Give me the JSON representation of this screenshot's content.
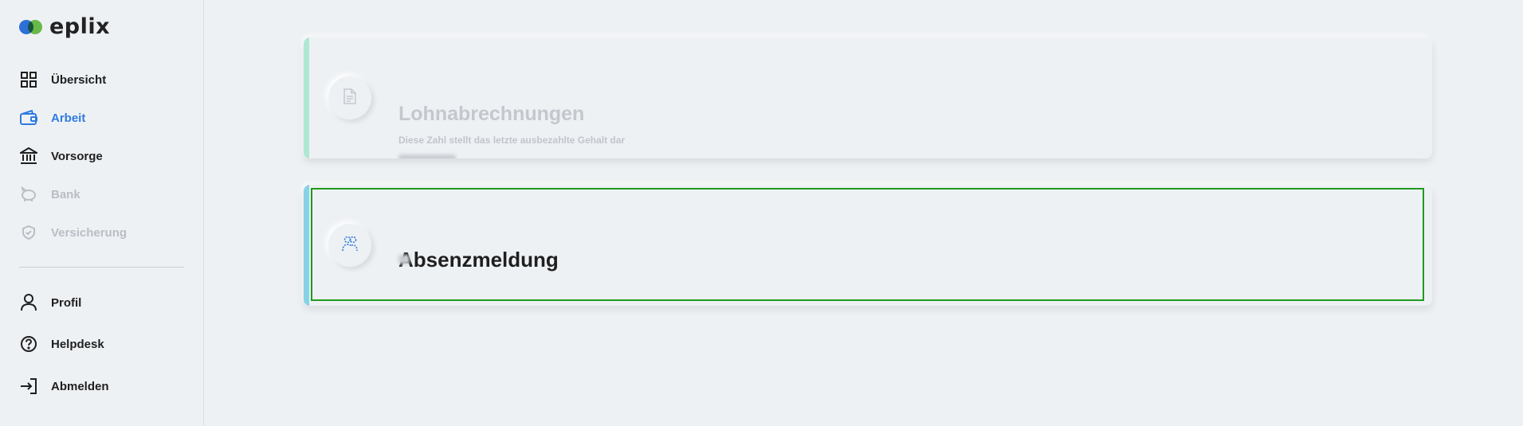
{
  "logo": {
    "text": "eplix"
  },
  "sidebar": {
    "items": [
      {
        "label": "Übersicht",
        "icon": "grid-icon",
        "state": "normal"
      },
      {
        "label": "Arbeit",
        "icon": "wallet-icon",
        "state": "active"
      },
      {
        "label": "Vorsorge",
        "icon": "bank-icon",
        "state": "normal"
      },
      {
        "label": "Bank",
        "icon": "piggy-bank-icon",
        "state": "disabled"
      },
      {
        "label": "Versicherung",
        "icon": "shield-icon",
        "state": "disabled"
      }
    ],
    "bottom_items": [
      {
        "label": "Profil",
        "icon": "user-icon"
      },
      {
        "label": "Helpdesk",
        "icon": "help-icon"
      },
      {
        "label": "Abmelden",
        "icon": "logout-icon"
      }
    ]
  },
  "cards": [
    {
      "title": "Lohnabrechnungen",
      "subtitle": "Diese Zahl stellt das letzte ausbezahlte Gehalt dar",
      "icon": "document-icon",
      "state": "disabled"
    },
    {
      "title": "Absenzmeldung",
      "icon": "absence-users-icon",
      "state": "focused"
    }
  ],
  "colors": {
    "accent_blue": "#2f7be0",
    "card1_accent": "#aee8d2",
    "card2_accent": "#86d3e6",
    "focus": "#1f9a1f"
  }
}
